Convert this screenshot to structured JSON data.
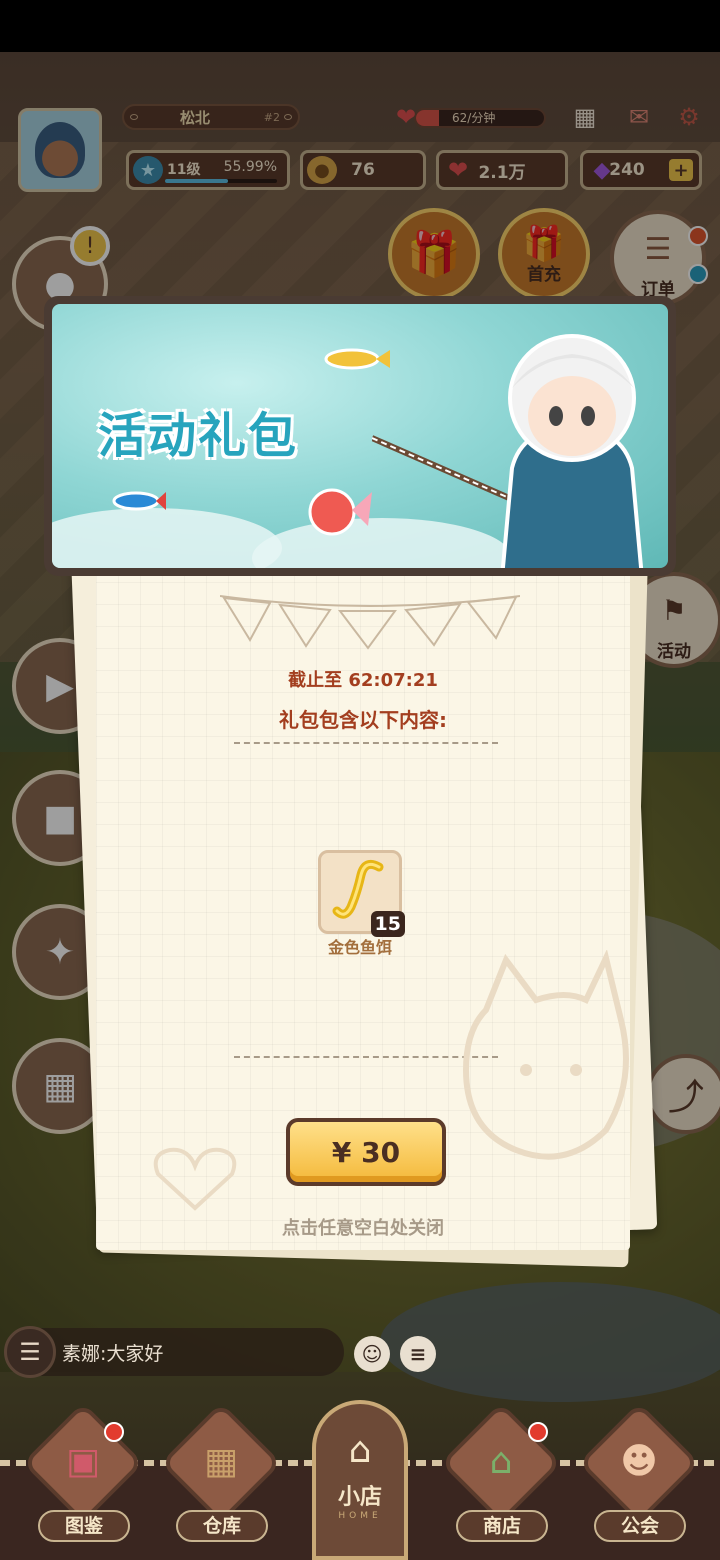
{
  "header": {
    "player_name": "松北",
    "rank": "#2",
    "heart_rate": "62/分钟",
    "heart_rate_fill": 0.18,
    "level": "11级",
    "level_progress": "55.99%",
    "coins": "76",
    "hearts": "2.1万",
    "gems": "240",
    "plus": "+"
  },
  "top_buttons": {
    "first_charge": "首充",
    "orders": "订单",
    "events": "活动"
  },
  "popup": {
    "banner_title": "活动礼包",
    "deadline_label": "截止至",
    "deadline_time": "62:07:21",
    "contains_label": "礼包包含以下内容:",
    "item_name": "金色鱼饵",
    "item_count": "15",
    "price": "¥ 30",
    "close_hint": "点击任意空白处关闭"
  },
  "chat": {
    "message": "素娜:大家好"
  },
  "nav": {
    "catalog": "图鉴",
    "warehouse": "仓库",
    "home": "小店",
    "home_sub": "HOME",
    "shop": "商店",
    "guild": "公会"
  },
  "colors": {
    "accent_red": "#a33e1f",
    "price_yellow": "#f4b93a",
    "panel_brown": "#5b3a2a"
  }
}
